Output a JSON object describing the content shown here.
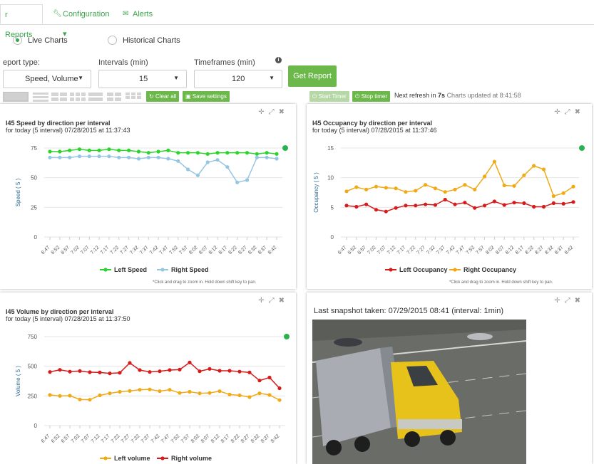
{
  "tabs": [
    {
      "label": "r Reports",
      "icon": ""
    },
    {
      "label": "Configuration ▾",
      "icon": "wrench-icon"
    },
    {
      "label": "Alerts",
      "icon": "envelope-icon"
    }
  ],
  "mode": {
    "live": "Live Charts",
    "historical": "Historical Charts"
  },
  "form": {
    "report_type_label": "eport type:",
    "report_type_value": "Speed, Volume",
    "intervals_label": "Intervals (min)",
    "intervals_value": "15",
    "timeframes_label": "Timeframes (min)",
    "timeframes_value": "120",
    "get_report": "Get Report"
  },
  "toolbar": {
    "clear_all": "Clear all",
    "save_settings": "Save settings",
    "start_timer": "Start Timer",
    "stop_timer": "Stop timer",
    "next_refresh_prefix": "Next refresh in ",
    "next_refresh_value": "7s",
    "updated": "Charts updated at 8:41:58"
  },
  "colors": {
    "accent": "#6cb84a",
    "green": "#2bd42b",
    "lightblue": "#96c6e2",
    "red": "#d61b1b",
    "orange": "#f0aa18"
  },
  "charts": {
    "speed": {
      "title": "I45 Speed by direction per interval",
      "subtitle": "for today (5 interval) 07/28/2015 at 11:37:43",
      "note": "*Click and drag to zoom in. Hold down shift key to pan."
    },
    "occupancy": {
      "title": "I45 Occupancy by direction per interval",
      "subtitle": "for today (5 interval) 07/28/2015 at 11:37:46",
      "note": "*Click and drag to zoom in. Hold down shift key to pan."
    },
    "volume": {
      "title": "I45 Volume by direction per interval",
      "subtitle": "for today (5 interval) 07/28/2015 at 11:37:50"
    }
  },
  "snapshot": {
    "title": "Last snapshot taken: 07/29/2015 08:41 (interval: 1min)"
  },
  "chart_data": [
    {
      "type": "line",
      "title": "I45 Speed by direction per interval",
      "ylabel": "Speed ( 5 )",
      "ylim": [
        0,
        75
      ],
      "yticks": [
        0,
        25,
        50,
        75
      ],
      "x": [
        "6:47",
        "6:52",
        "6:57",
        "7:02",
        "7:07",
        "7:12",
        "7:17",
        "7:22",
        "7:27",
        "7:32",
        "7:37",
        "7:42",
        "7:47",
        "7:52",
        "7:57",
        "8:02",
        "8:07",
        "8:12",
        "8:17",
        "8:22",
        "8:27",
        "8:32",
        "8:37",
        "8:42"
      ],
      "series": [
        {
          "name": "Left Speed",
          "color": "#2bd42b",
          "values": [
            72,
            72,
            73,
            74,
            73,
            73,
            74,
            73,
            73,
            72,
            71,
            72,
            73,
            71,
            71,
            71,
            70,
            71,
            71,
            71,
            71,
            70,
            71,
            70
          ]
        },
        {
          "name": "Right Speed",
          "color": "#96c6e2",
          "values": [
            67,
            67,
            67,
            68,
            68,
            68,
            68,
            67,
            67,
            66,
            67,
            67,
            66,
            64,
            57,
            52,
            63,
            65,
            59,
            46,
            48,
            67,
            67,
            66
          ]
        }
      ]
    },
    {
      "type": "line",
      "title": "I45 Occupancy by direction per interval",
      "ylabel": "Occupancy ( 5 )",
      "ylim": [
        0,
        15
      ],
      "yticks": [
        0,
        5,
        10,
        15
      ],
      "x": [
        "6:47",
        "6:52",
        "6:57",
        "7:02",
        "7:07",
        "7:12",
        "7:17",
        "7:22",
        "7:27",
        "7:32",
        "7:37",
        "7:42",
        "7:47",
        "7:52",
        "7:57",
        "8:02",
        "8:07",
        "8:12",
        "8:17",
        "8:22",
        "8:27",
        "8:32",
        "8:37",
        "8:42"
      ],
      "series": [
        {
          "name": "Left Occupancy",
          "color": "#d61b1b",
          "values": [
            5.3,
            5.1,
            5.5,
            4.6,
            4.3,
            4.9,
            5.3,
            5.3,
            5.5,
            5.4,
            6.3,
            5.5,
            5.8,
            4.9,
            5.3,
            6.0,
            5.4,
            5.8,
            5.7,
            5.1,
            5.1,
            5.7,
            5.6,
            5.9
          ]
        },
        {
          "name": "Right Occupancy",
          "color": "#f0aa18",
          "values": [
            7.7,
            8.4,
            8.0,
            8.5,
            8.3,
            8.2,
            7.6,
            7.8,
            8.8,
            8.2,
            7.6,
            8.0,
            8.8,
            8.0,
            10.2,
            12.7,
            8.7,
            8.6,
            10.4,
            12.0,
            11.4,
            6.9,
            7.4,
            8.5
          ]
        }
      ]
    },
    {
      "type": "line",
      "title": "I45 Volume by direction per interval",
      "ylabel": "Volume ( 5 )",
      "ylim": [
        0,
        750
      ],
      "yticks": [
        0,
        250,
        500,
        750
      ],
      "x": [
        "6:47",
        "6:52",
        "6:57",
        "7:02",
        "7:07",
        "7:12",
        "7:17",
        "7:22",
        "7:27",
        "7:32",
        "7:37",
        "7:42",
        "7:47",
        "7:52",
        "7:57",
        "8:02",
        "8:07",
        "8:12",
        "8:17",
        "8:22",
        "8:27",
        "8:32",
        "8:37",
        "8:42"
      ],
      "series": [
        {
          "name": "Left volume",
          "color": "#f0aa18",
          "values": [
            258,
            250,
            252,
            220,
            218,
            255,
            272,
            285,
            292,
            302,
            305,
            290,
            302,
            275,
            285,
            272,
            275,
            290,
            262,
            255,
            240,
            272,
            258,
            215
          ]
        },
        {
          "name": "Right volume",
          "color": "#d61b1b",
          "values": [
            452,
            470,
            455,
            460,
            450,
            448,
            440,
            445,
            528,
            468,
            452,
            458,
            468,
            472,
            532,
            458,
            478,
            462,
            462,
            455,
            448,
            380,
            405,
            315
          ]
        }
      ]
    }
  ]
}
